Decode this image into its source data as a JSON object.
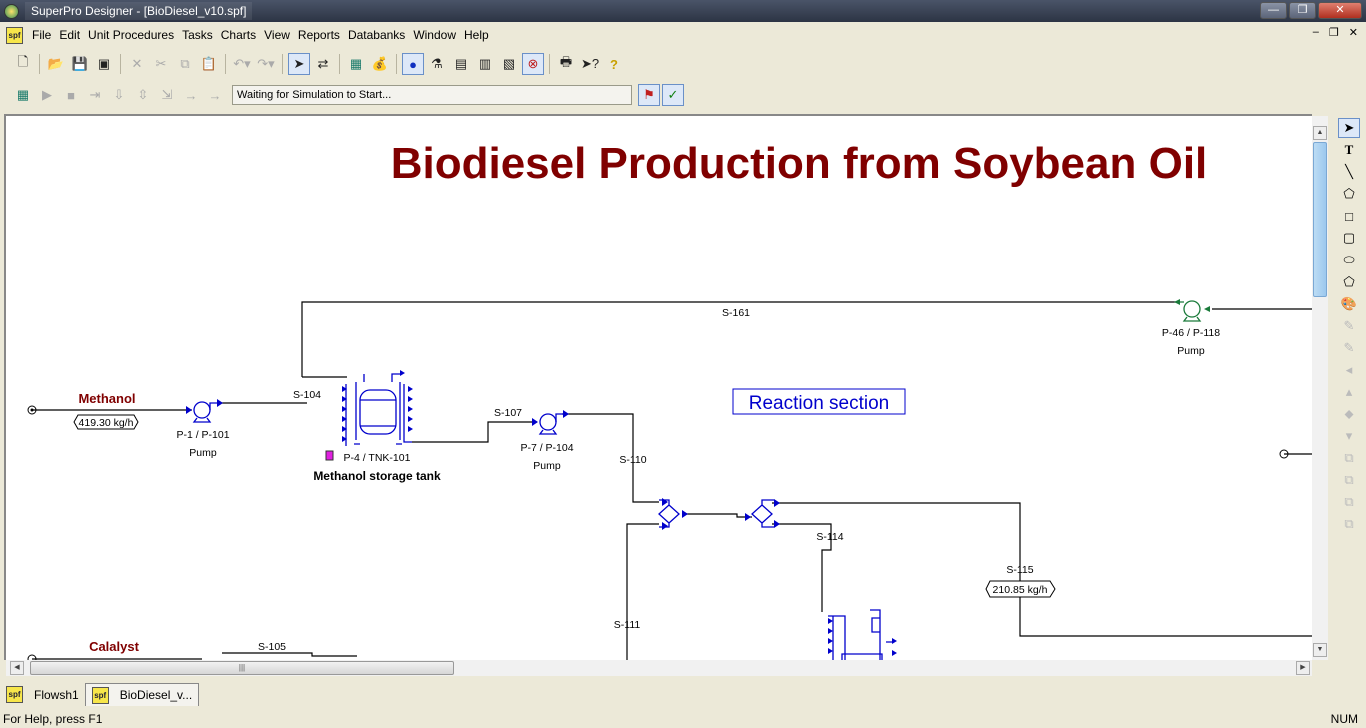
{
  "window": {
    "title": "SuperPro Designer - [BioDiesel_v10.spf]",
    "buttons": [
      "—",
      "❐",
      "✕"
    ]
  },
  "menu": {
    "icon": "spf",
    "items": [
      "File",
      "Edit",
      "Unit Procedures",
      "Tasks",
      "Charts",
      "View",
      "Reports",
      "Databanks",
      "Window",
      "Help"
    ],
    "mdi": [
      "–",
      "❐",
      "✕"
    ]
  },
  "toolbar1": [
    "new-icon",
    "open-icon",
    "save-icon",
    "save-all-icon",
    "cut-icon",
    "scissors-icon",
    "copy-icon",
    "paste-icon",
    "undo-icon",
    "redo-icon",
    "select-icon",
    "connect-icon",
    "calculator-icon",
    "economics-icon",
    "shapes-icon",
    "equipment-icon",
    "report-icon",
    "table-icon",
    "databank-icon",
    "simulate-icon",
    "print-icon",
    "context-help-icon",
    "help-icon"
  ],
  "toolbar2": {
    "status": "Waiting for Simulation to Start..."
  },
  "flowsheet": {
    "title": "Biodiesel Production from Soybean Oil",
    "section": "Reaction section",
    "title_color": "#800000",
    "stream_color": "#000000",
    "equipment_color": "#0000cc",
    "inputs": [
      {
        "name": "Methanol",
        "rate": "419.30 kg/h"
      },
      {
        "name": "Calalyst"
      }
    ],
    "streams": [
      "S-161",
      "S-104",
      "S-107",
      "S-110",
      "S-111",
      "S-114",
      "S-115",
      "S-105"
    ],
    "s115_rate": "210.85 kg/h",
    "units": [
      {
        "id": "P-1 / P-101",
        "type": "Pump"
      },
      {
        "id": "P-4 / TNK-101",
        "type": "Methanol storage tank"
      },
      {
        "id": "P-7 / P-104",
        "type": "Pump"
      },
      {
        "id": "P-46 / P-118",
        "type": "Pump"
      }
    ]
  },
  "palette": [
    "select-icon",
    "text-icon",
    "line-icon",
    "polygon-icon",
    "rectangle-icon",
    "rounded-rect-icon",
    "ellipse-icon",
    "pentagon-icon"
  ],
  "tabs": [
    {
      "label": "Flowsh1"
    },
    {
      "label": "BioDiesel_v..."
    }
  ],
  "status": {
    "help": "For Help, press F1",
    "num": "NUM"
  }
}
